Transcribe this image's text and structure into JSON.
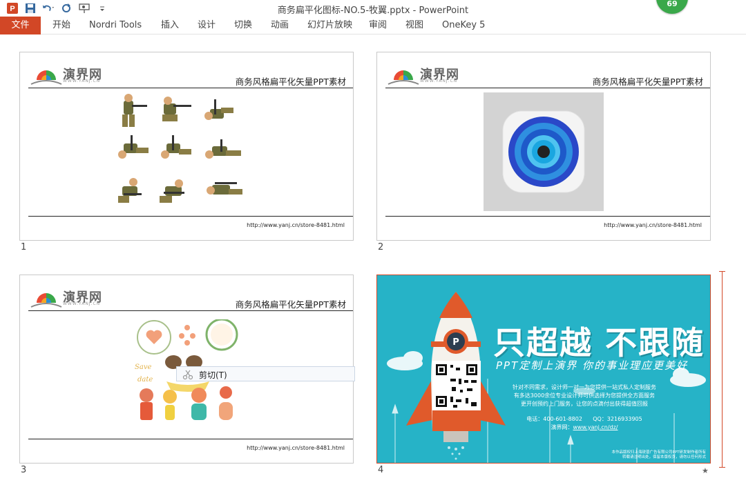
{
  "window": {
    "title": "商务扁平化图标-NO.5-牧翼.pptx - PowerPoint",
    "badge_count": "69"
  },
  "quick_access": {
    "icons": [
      "powerpoint-logo-icon",
      "save-icon",
      "undo-icon",
      "redo-icon",
      "presentation-icon",
      "customize-qat-icon"
    ]
  },
  "ribbon": {
    "tabs": [
      "文件",
      "开始",
      "Nordri Tools",
      "插入",
      "设计",
      "切换",
      "动画",
      "幻灯片放映",
      "审阅",
      "视图",
      "OneKey 5"
    ]
  },
  "slides": [
    {
      "number": "1",
      "logo_text": "演界网",
      "logo_sub": "WWW.YANJ.CN",
      "caption": "商务风格扁平化矢量PPT素材",
      "footer_url": "http://www.yanj.cn/store-8481.html",
      "content": "soldier-sprites"
    },
    {
      "number": "2",
      "logo_text": "演界网",
      "logo_sub": "WWW.YANJ.CN",
      "caption": "商务风格扁平化矢量PPT素材",
      "footer_url": "http://www.yanj.cn/store-8481.html",
      "content": "camera-app-icon"
    },
    {
      "number": "3",
      "logo_text": "演界网",
      "logo_sub": "WWW.YANJ.CN",
      "caption": "商务风格扁平化矢量PPT素材",
      "footer_url": "http://www.yanj.cn/store-8481.html",
      "content": "wedding-illustrations"
    },
    {
      "number": "4",
      "content": "rocket-ad"
    }
  ],
  "slide4": {
    "headline": "只超越 不跟随",
    "subheadline": "PPT定制上演界 你的事业理应更美好",
    "lines": [
      "针对不同需求，设计师一对一为您提供一站式私人定制服务",
      "有多达3000余位专业设计师可供选择为您提供全方面服务",
      "更开创预约上门服务，让您的点滴付出获得超值回报"
    ],
    "phone": "电话：400-601-8802",
    "qq": "QQ：3216933905",
    "site_label": "演界网：",
    "site_url": "www.yanj.cn/dz/",
    "fine_print_1": "本作品版权归上海锐普广告有限公司PPT研发制作者所有",
    "fine_print_2": "转载请注明出处，保留本版权页，请勿以任何形式"
  },
  "context_menu": {
    "item": "剪切(T)"
  },
  "colors": {
    "file_tab": "#d24726",
    "badge": "#3aa84a",
    "slide4_bg": "#26b3c7"
  }
}
